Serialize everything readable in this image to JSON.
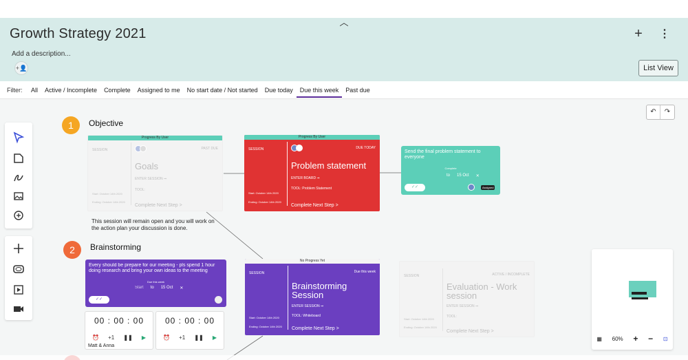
{
  "header": {
    "title": "Growth Strategy 2021",
    "add_description": "Add a description...",
    "list_view": "List View",
    "add_icon": "plus-icon",
    "menu_icon": "kebab-icon"
  },
  "filters": {
    "label": "Filter:",
    "items": [
      "All",
      "Active / Incomplete",
      "Complete",
      "Assigned to me",
      "No start date / Not started",
      "Due today",
      "Due this week",
      "Past due"
    ],
    "active": "Due this week"
  },
  "sections": [
    {
      "number": "1",
      "title": "Objective",
      "color": "#f5a623",
      "desc": "This session will remain open and you will work on the action plan your discussion is done."
    },
    {
      "number": "2",
      "title": "Brainstorming",
      "color": "#ef6a3a"
    }
  ],
  "cards": {
    "goals": {
      "tag": "Progress By User",
      "session": "SESSION",
      "status": "PAST DUE",
      "title": "Goals",
      "enter": "ENTER SESSION ➞",
      "tool": "TOOL:",
      "start": "Start: October 14th 2020",
      "end": "Ending: October 14th 2020",
      "next": "Complete Next Step >"
    },
    "problem": {
      "tag": "Progress By User",
      "session": "SESSION",
      "status": "DUE TODAY",
      "title": "Problem statement",
      "enter": "ENTER BOARD ➞",
      "tool": "TOOL: Problem Statement",
      "start": "Start: October 14th 2020",
      "end": "Ending: October 14th 2020",
      "next": "Complete Next Step >",
      "color": "#e03333"
    },
    "brainstorm": {
      "tag": "No Progress Yet",
      "session": "SESSION",
      "status": "Due this week",
      "title": "Brainstorming Session",
      "enter": "ENTER SESSION ➞",
      "tool": "TOOL: Whiteboard",
      "start": "Start: October 14th 2020",
      "end": "Ending: October 14th 2020",
      "next": "Complete Next Step >",
      "color": "#6b3fc0"
    },
    "evaluation": {
      "session": "SESSION",
      "status": "ACTIVE / INCOMPLETE",
      "title": "Evaluation - Work session",
      "enter": "ENTER SESSION ➞",
      "tool": "TOOL:",
      "start": "Start: October 14th 2020",
      "end": "Ending: October 14th 2020",
      "next": "Complete Next Step >"
    }
  },
  "tasks": {
    "final": {
      "text": "Send the final problem statement to everyone",
      "complete": "Complete",
      "to": "to",
      "end": "15 Oct",
      "x": "✕",
      "assigned": "Assigned",
      "color": "#5ccfb8"
    },
    "prepare": {
      "text": "Every should be prepare for our meeting - pls spend 1 hour doing research and bring your own ideas to the meeting",
      "due": "Due this week",
      "start": "Start",
      "to": "to",
      "end": "15 Oct",
      "x": "✕",
      "color": "#6b3fc0"
    }
  },
  "timers": [
    {
      "time": "00 : 00 : 00",
      "inc": "+1"
    },
    {
      "time": "00 : 00 : 00",
      "inc": "+1"
    }
  ],
  "participants": "Matt  &  Anna",
  "minimap": {
    "zoom": "60%"
  }
}
